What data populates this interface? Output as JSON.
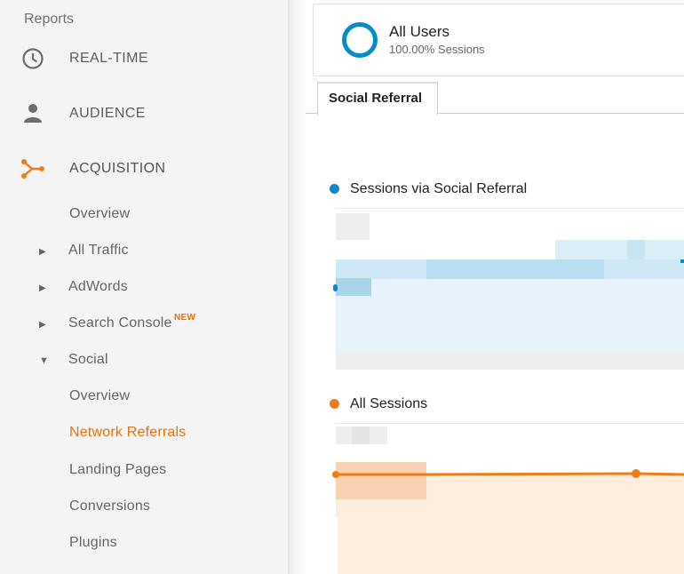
{
  "sidebar": {
    "reports_label": "Reports",
    "sections": [
      {
        "label": "REAL-TIME",
        "icon": "clock-icon"
      },
      {
        "label": "AUDIENCE",
        "icon": "person-icon"
      },
      {
        "label": "ACQUISITION",
        "icon": "acquisition-icon"
      }
    ],
    "acquisition_items": {
      "overview": "Overview",
      "all_traffic": "All Traffic",
      "adwords": "AdWords",
      "search_console": "Search Console",
      "search_console_badge": "NEW",
      "social": "Social"
    },
    "social_items": [
      "Overview",
      "Network Referrals",
      "Landing Pages",
      "Conversions",
      "Plugins"
    ],
    "current_item": "Network Referrals"
  },
  "segment": {
    "name": "All Users",
    "subtitle": "100.00% Sessions"
  },
  "tabs": [
    "Social Referral"
  ],
  "chart": {
    "series": [
      {
        "name": "Sessions via Social Referral",
        "color": "#058dc7"
      },
      {
        "name": "All Sessions",
        "color": "#ed7e17"
      }
    ]
  },
  "colors": {
    "accent": "#e8710a",
    "blue": "#058dc7",
    "orange": "#ed7e17"
  }
}
